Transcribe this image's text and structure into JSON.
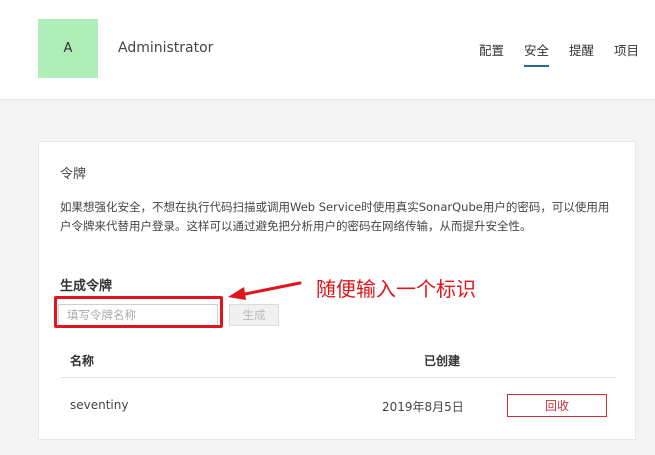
{
  "header": {
    "avatar_letter": "A",
    "username": "Administrator",
    "nav": [
      {
        "label": "配置"
      },
      {
        "label": "安全"
      },
      {
        "label": "提醒"
      },
      {
        "label": "项目"
      }
    ],
    "active_tab": "安全"
  },
  "token_card": {
    "title": "令牌",
    "description": "如果想强化安全，不想在执行代码扫描或调用Web Service时使用真实SonarQube用户的密码，可以使用用户令牌来代替用户登录。这样可以通过避免把分析用户的密码在网络传输，从而提升安全性。",
    "generate_title": "生成令牌",
    "input_placeholder": "填写令牌名称",
    "input_value": "",
    "generate_button": "生成",
    "table": {
      "headers": {
        "name": "名称",
        "created": "已创建"
      },
      "rows": [
        {
          "name": "seventiny",
          "created": "2019年8月5日",
          "action": "回收"
        }
      ]
    }
  },
  "annotation": {
    "text": "随便输入一个标识",
    "color": "#e0141a"
  },
  "colors": {
    "accent": "#236a97",
    "avatar_bg": "#aeeeb9",
    "danger": "#d02f3a"
  }
}
